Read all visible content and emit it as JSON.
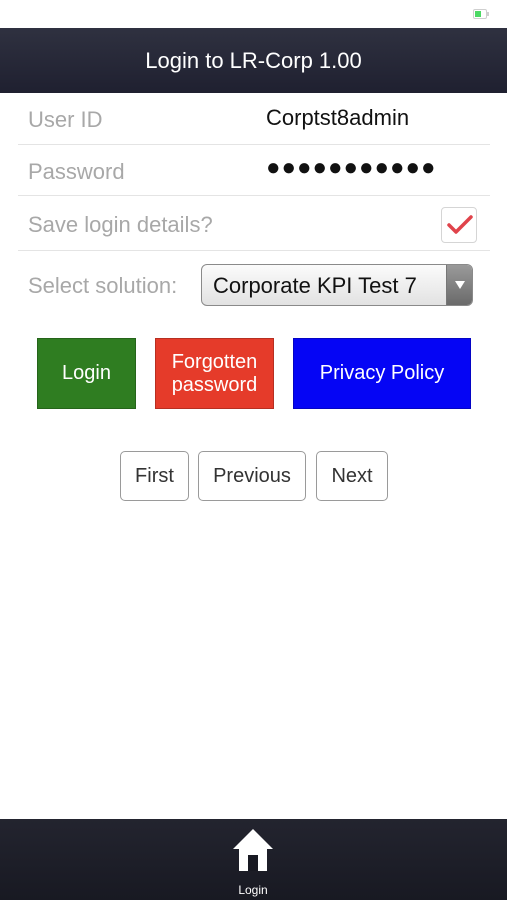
{
  "header": {
    "title": "Login to LR-Corp 1.00"
  },
  "form": {
    "user_id": {
      "label": "User ID",
      "value": "Corptst8admin"
    },
    "password": {
      "label": "Password",
      "value": "●●●●●●●●●●●"
    },
    "save_login": {
      "label": "Save login details?",
      "checked": true
    },
    "solution": {
      "label": "Select solution:",
      "selected": "Corporate KPI Test 7"
    }
  },
  "actions": {
    "login": "Login",
    "forgot_line1": "Forgotten",
    "forgot_line2": "password",
    "privacy": "Privacy Policy"
  },
  "pager": {
    "first": "First",
    "previous": "Previous",
    "next": "Next"
  },
  "tabbar": {
    "login_tab": {
      "label": "Login",
      "icon": "home-icon"
    }
  },
  "colors": {
    "header_bg": "#2f3140",
    "login_green": "#2f7d21",
    "forgot_red": "#e53b2a",
    "privacy_blue": "#0505f5",
    "check_red": "#e0434b"
  }
}
